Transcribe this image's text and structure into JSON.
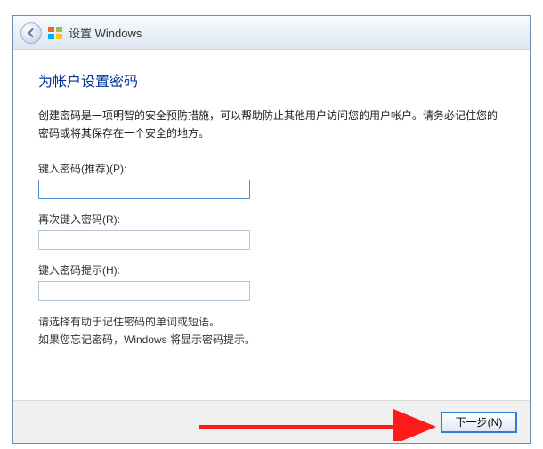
{
  "titlebar": {
    "title": "设置 Windows"
  },
  "content": {
    "heading": "为帐户设置密码",
    "description": "创建密码是一项明智的安全预防措施，可以帮助防止其他用户访问您的用户帐户。请务必记住您的密码或将其保存在一个安全的地方。",
    "password_label": "键入密码(推荐)(P):",
    "password_value": "",
    "confirm_label": "再次键入密码(R):",
    "confirm_value": "",
    "hint_label": "键入密码提示(H):",
    "hint_value": "",
    "helper1": "请选择有助于记住密码的单词或短语。",
    "helper2": "如果您忘记密码，Windows 将显示密码提示。"
  },
  "footer": {
    "next_label": "下一步(N)"
  }
}
